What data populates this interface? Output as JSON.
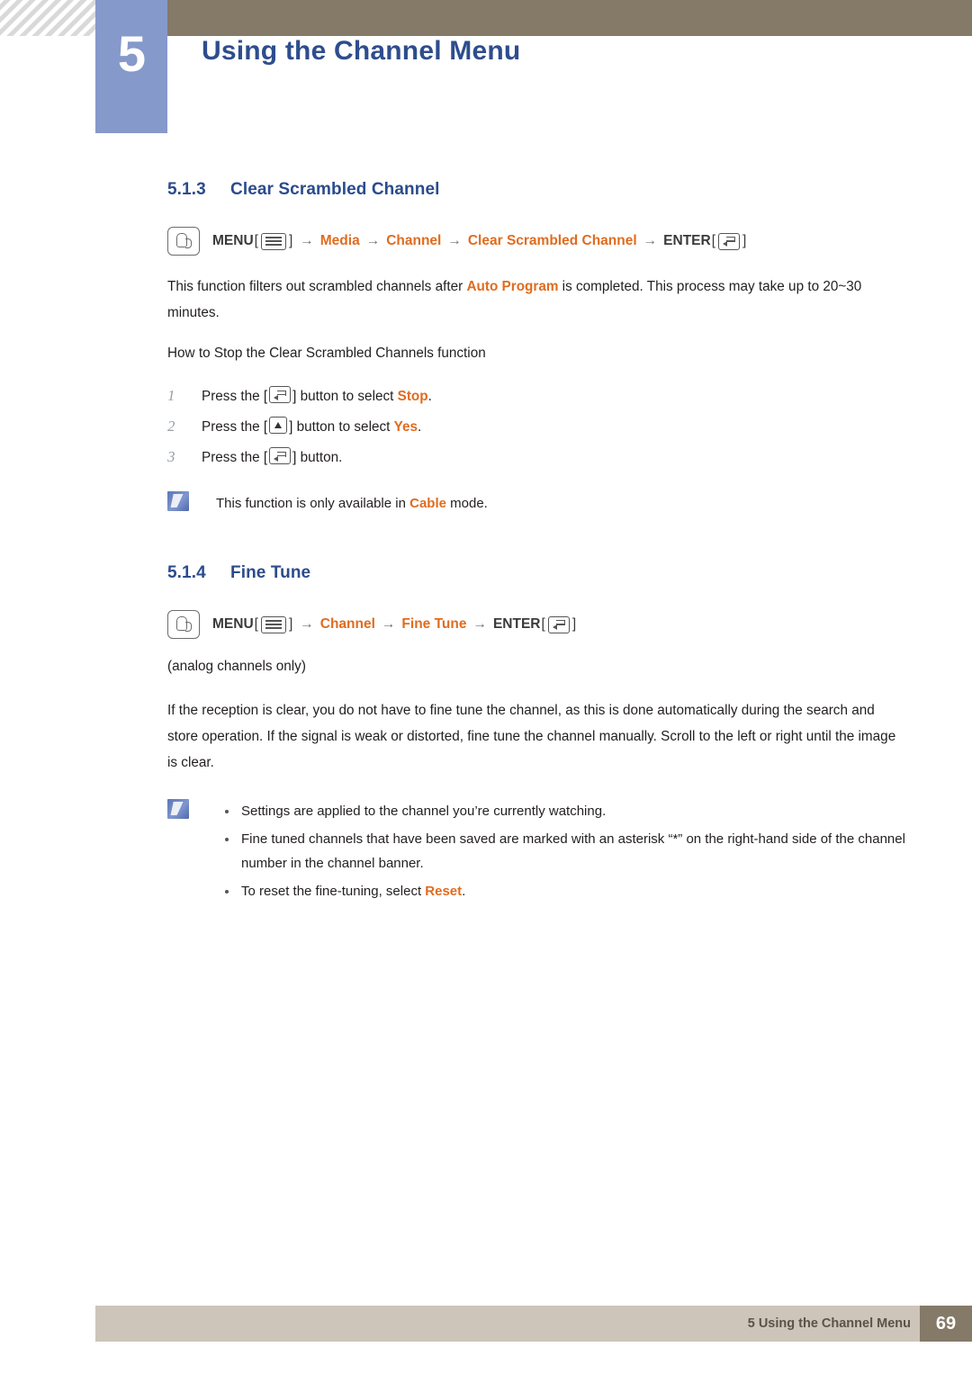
{
  "header": {
    "chapter_number": "5",
    "chapter_title": "Using the Channel Menu"
  },
  "sections": [
    {
      "number": "5.1.3",
      "title": "Clear Scrambled Channel",
      "menu_path": {
        "menu_label": "MENU",
        "menu_icon": "menu-glyph-icon",
        "arrow": "→",
        "items": [
          "Media",
          "Channel",
          "Clear Scrambled Channel"
        ],
        "enter_label": "ENTER",
        "enter_icon": "enter-glyph-icon",
        "bracket_open": "[",
        "bracket_close": "]"
      },
      "paragraph_1_a": "This function filters out scrambled channels after ",
      "paragraph_1_hl": "Auto Program",
      "paragraph_1_b": " is completed. This process may take up to 20~30 minutes.",
      "paragraph_2": "How to Stop the Clear Scrambled Channels function",
      "steps": [
        {
          "num": "1",
          "text_a": "Press the [",
          "icon": "enter-glyph-icon",
          "text_b": "] button to select ",
          "highlight": "Stop",
          "text_c": "."
        },
        {
          "num": "2",
          "text_a": "Press the [",
          "icon": "up-arrow-glyph-icon",
          "text_b": "] button to select ",
          "highlight": "Yes",
          "text_c": "."
        },
        {
          "num": "3",
          "text_a": "Press the [",
          "icon": "enter-glyph-icon",
          "text_b": "] button.",
          "highlight": "",
          "text_c": ""
        }
      ],
      "note": {
        "text_a": "This function is only available in ",
        "highlight": "Cable",
        "text_b": " mode."
      }
    },
    {
      "number": "5.1.4",
      "title": "Fine Tune",
      "menu_path": {
        "menu_label": "MENU",
        "menu_icon": "menu-glyph-icon",
        "arrow": "→",
        "items": [
          "Channel",
          "Fine Tune"
        ],
        "enter_label": "ENTER",
        "enter_icon": "enter-glyph-icon",
        "bracket_open": "[",
        "bracket_close": "]"
      },
      "subnote": "(analog channels only)",
      "paragraph_1": "If the reception is clear, you do not have to fine tune the channel, as this is done automatically during the search and store operation. If the signal is weak or distorted, fine tune the channel manually. Scroll to the left or right until the image is clear.",
      "notes": [
        {
          "text_a": "Settings are applied to the channel you’re currently watching.",
          "highlight": "",
          "text_b": ""
        },
        {
          "text_a": "Fine tuned channels that have been saved are marked with an asterisk “*” on the right-hand side of the channel number in the channel banner.",
          "highlight": "",
          "text_b": ""
        },
        {
          "text_a": "To reset the fine-tuning, select ",
          "highlight": "Reset",
          "text_b": "."
        }
      ]
    }
  ],
  "footer": {
    "text": "5 Using the Channel Menu",
    "page": "69"
  },
  "colors": {
    "heading_blue": "#2b4b8c",
    "accent_orange": "#e06c1f",
    "header_bar": "#857a68",
    "header_blue": "#8699cb",
    "footer_bar": "#cdc5b9"
  }
}
